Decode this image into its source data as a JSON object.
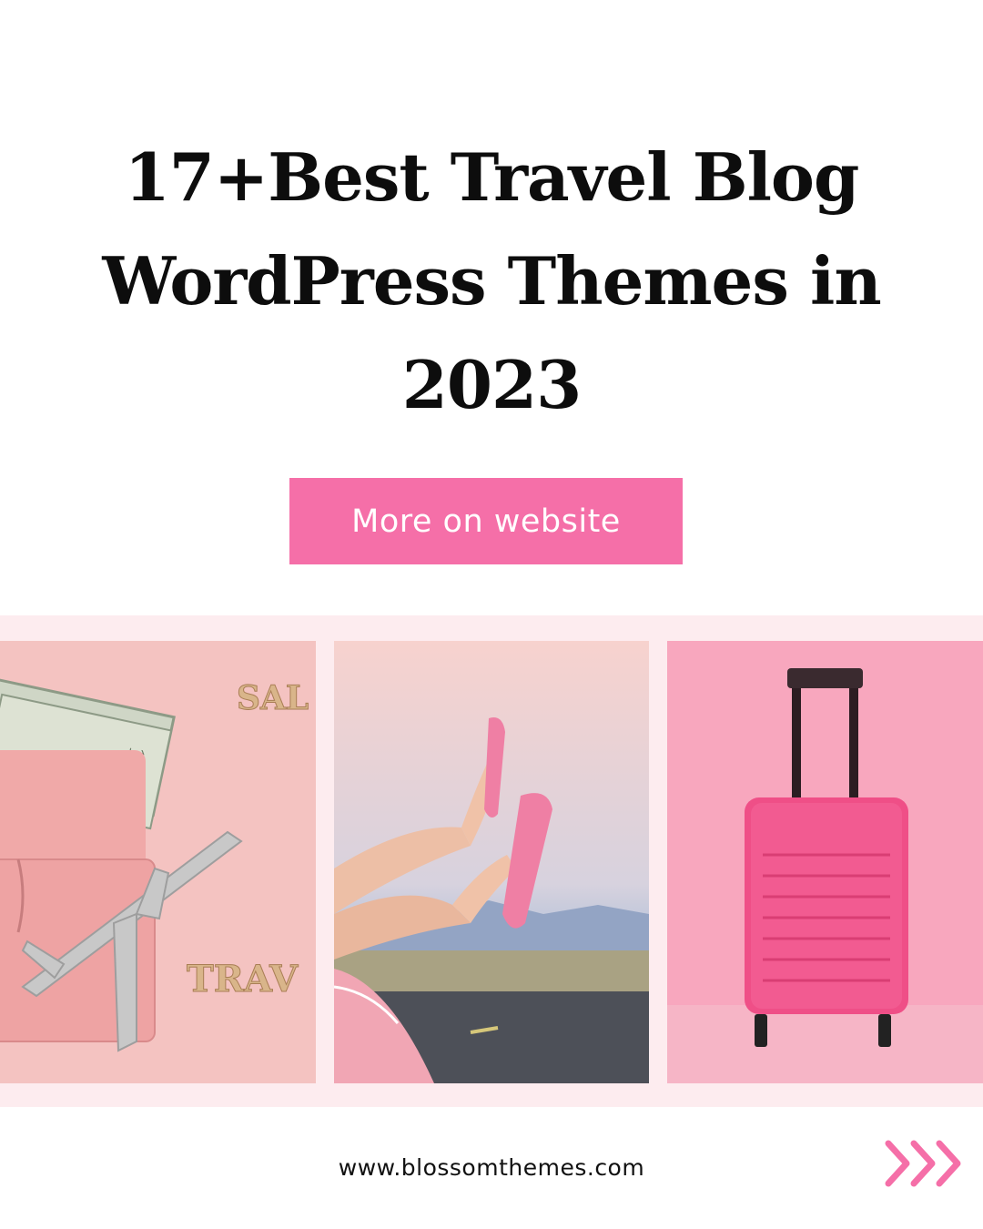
{
  "headline": {
    "line1": "17+Best Travel Blog",
    "line2": "WordPress Themes in",
    "line3": "2023"
  },
  "cta": {
    "label": "More on website"
  },
  "photos": [
    {
      "icon": "passport-money-airplane-photo",
      "letters_top": "SAL",
      "letters_bottom": "TRAV"
    },
    {
      "icon": "feet-flip-flops-photo"
    },
    {
      "icon": "pink-suitcase-photo"
    }
  ],
  "footer": {
    "url": "www.blossomthemes.com",
    "next_icon": "triple-chevron-right-icon"
  },
  "colors": {
    "accent_pink": "#f56fa8",
    "band_pink": "#fdecef",
    "text": "#0d0d0d"
  }
}
